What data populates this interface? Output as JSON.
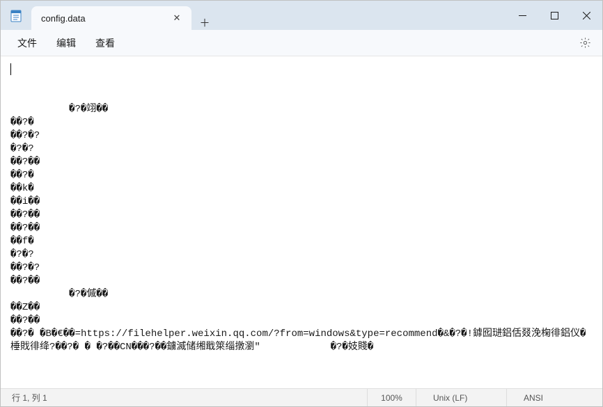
{
  "titlebar": {
    "tab_title": "config.data",
    "close_glyph": "✕",
    "newtab_glyph": "＋"
  },
  "menubar": {
    "file": "文件",
    "edit": "编辑",
    "view": "查看"
  },
  "editor": {
    "lines": [
      "",
      "          �?�翊��",
      "��?�",
      "��?�?",
      "�?�?",
      "��?��",
      "��?�",
      "��k�",
      "��i��",
      "��?��",
      "��?��",
      "��f�",
      "�?�?",
      "��?�?",
      "��?��",
      "          �?�傶��",
      "��Z��",
      "��?��",
      "��?� �B�€��=https://filehelper.weixin.qq.com/?from=windows&type=recommend�&�?�!鎼囮琎鋁佸叕浼椈徘鋁仪�棰戝徘绛?��?� � �?��CN���?��鐪滅储缃戢箂缁撴瀏\"            �?�妓賤�"
    ]
  },
  "statusbar": {
    "position": "行 1, 列 1",
    "zoom": "100%",
    "eol": "Unix (LF)",
    "encoding": "ANSI"
  }
}
